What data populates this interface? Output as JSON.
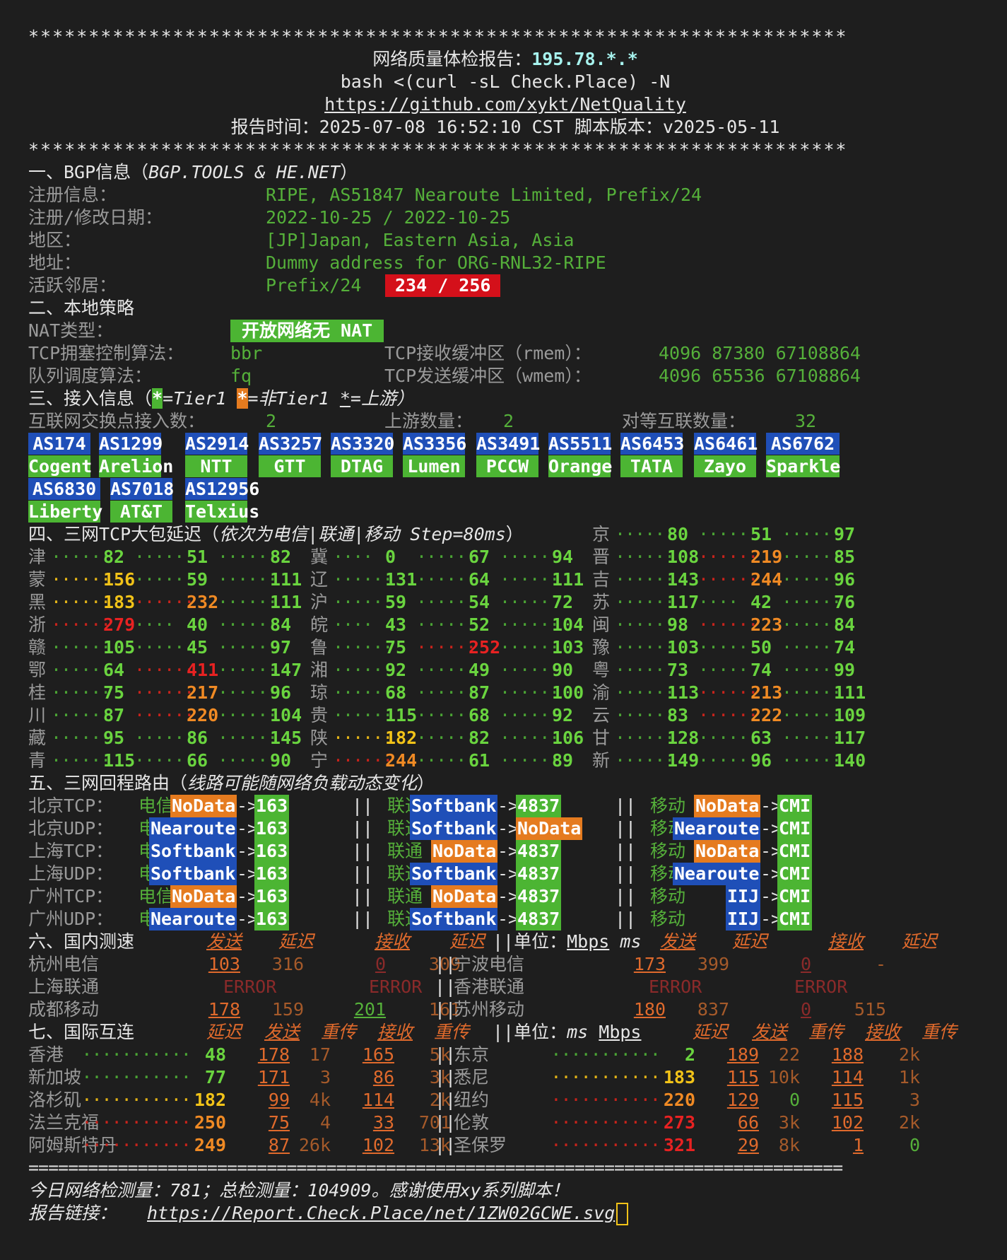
{
  "stars": "********************************************************************",
  "title_label": "网络质量体检报告：",
  "title_ip": "195.78.*.*",
  "cmd": "bash <(curl -sL Check.Place) -N",
  "repo": "https://github.com/xykt/NetQuality",
  "report_time": "报告时间：2025-07-08 16:52:10 CST  脚本版本：v2025-05-11",
  "sec1": {
    "title": "一、BGP信息（",
    "title_src": "BGP.TOOLS & HE.NET",
    "title_end": "）",
    "rows": [
      {
        "k": "注册信息：",
        "v": "RIPE, AS51847 Nearoute Limited, Prefix/24"
      },
      {
        "k": "注册/修改日期：",
        "v": "2022-10-25 / 2022-10-25"
      },
      {
        "k": "地区：",
        "v": "[JP]Japan, Eastern Asia, Asia"
      },
      {
        "k": "地址：",
        "v": "Dummy address for ORG-RNL32-RIPE"
      }
    ],
    "neighbor_k": "活跃邻居：",
    "neighbor_v": "Prefix/24",
    "neighbor_badge": "234 / 256"
  },
  "sec2": {
    "title": "二、本地策略",
    "nat_k": "NAT类型：",
    "nat_v": "开放网络无 NAT",
    "tcp_k": "TCP拥塞控制算法：",
    "tcp_v": "bbr",
    "rmem_k": "TCP接收缓冲区（rmem）：",
    "rmem_v": "4096 87380 67108864",
    "q_k": "队列调度算法：",
    "q_v": "fq",
    "wmem_k": "TCP发送缓冲区（wmem）：",
    "wmem_v": "4096 65536 67108864"
  },
  "sec3": {
    "title": "三、接入信息（",
    "t1": "*",
    "t1_txt": "=Tier1 ",
    "t2": "*",
    "t2_txt": "=非Tier1 ",
    "t3": "*",
    "t3_txt": "=上游）",
    "ix_k": "互联网交换点接入数：",
    "ix_v": "2",
    "up_k": "上游数量：",
    "up_v": "2",
    "peer_k": "对等互联数量：",
    "peer_v": "32",
    "asns": [
      {
        "as": "AS174",
        "name": "Cogent"
      },
      {
        "as": "AS1299",
        "name": "Arelion"
      },
      {
        "as": "AS2914",
        "name": "NTT"
      },
      {
        "as": "AS3257",
        "name": "GTT"
      },
      {
        "as": "AS3320",
        "name": "DTAG"
      },
      {
        "as": "AS3356",
        "name": "Lumen"
      },
      {
        "as": "AS3491",
        "name": "PCCW"
      },
      {
        "as": "AS5511",
        "name": "Orange"
      },
      {
        "as": "AS6453",
        "name": "TATA"
      },
      {
        "as": "AS6461",
        "name": "Zayo"
      },
      {
        "as": "AS6762",
        "name": "Sparkle"
      },
      {
        "as": "AS6830",
        "name": "Liberty"
      },
      {
        "as": "AS7018",
        "name": "AT&T"
      },
      {
        "as": "AS12956",
        "name": "Telxius"
      }
    ]
  },
  "sec4": {
    "title": "四、三网TCP大包延迟（",
    "title_it": "依次为电信|联通|移动 Step=80ms",
    "title_end": "）",
    "rows": [
      [
        {
          "p": "津",
          "v": [
            82,
            51,
            82
          ]
        },
        {
          "p": "冀",
          "v": [
            0,
            67,
            94
          ]
        },
        {
          "p": "晋",
          "v": [
            108,
            219,
            85
          ]
        }
      ],
      [
        {
          "p": "蒙",
          "v": [
            156,
            59,
            111
          ]
        },
        {
          "p": "辽",
          "v": [
            131,
            64,
            111
          ]
        },
        {
          "p": "吉",
          "v": [
            143,
            244,
            96
          ]
        }
      ],
      [
        {
          "p": "黑",
          "v": [
            183,
            232,
            111
          ]
        },
        {
          "p": "沪",
          "v": [
            59,
            54,
            72
          ]
        },
        {
          "p": "苏",
          "v": [
            117,
            42,
            76
          ]
        }
      ],
      [
        {
          "p": "浙",
          "v": [
            279,
            40,
            84
          ]
        },
        {
          "p": "皖",
          "v": [
            43,
            52,
            104
          ]
        },
        {
          "p": "闽",
          "v": [
            98,
            223,
            84
          ]
        }
      ],
      [
        {
          "p": "赣",
          "v": [
            105,
            45,
            97
          ]
        },
        {
          "p": "鲁",
          "v": [
            75,
            252,
            103
          ]
        },
        {
          "p": "豫",
          "v": [
            103,
            50,
            74
          ]
        }
      ],
      [
        {
          "p": "鄂",
          "v": [
            64,
            411,
            147
          ]
        },
        {
          "p": "湘",
          "v": [
            92,
            49,
            90
          ]
        },
        {
          "p": "粤",
          "v": [
            73,
            74,
            99
          ]
        }
      ],
      [
        {
          "p": "桂",
          "v": [
            75,
            217,
            96
          ]
        },
        {
          "p": "琼",
          "v": [
            68,
            87,
            100
          ]
        },
        {
          "p": "渝",
          "v": [
            113,
            213,
            111
          ]
        }
      ],
      [
        {
          "p": "川",
          "v": [
            87,
            220,
            104
          ]
        },
        {
          "p": "贵",
          "v": [
            115,
            68,
            92
          ]
        },
        {
          "p": "云",
          "v": [
            83,
            222,
            109
          ]
        }
      ],
      [
        {
          "p": "藏",
          "v": [
            95,
            86,
            145
          ]
        },
        {
          "p": "陕",
          "v": [
            182,
            82,
            106
          ]
        },
        {
          "p": "甘",
          "v": [
            128,
            63,
            117
          ]
        }
      ],
      [
        {
          "p": "青",
          "v": [
            115,
            66,
            90
          ]
        },
        {
          "p": "宁",
          "v": [
            244,
            61,
            89
          ]
        },
        {
          "p": "新",
          "v": [
            149,
            96,
            140
          ]
        }
      ]
    ],
    "jing": {
      "p": "京",
      "v": [
        80,
        51,
        97
      ]
    }
  },
  "sec5": {
    "title": "五、三网回程路由（",
    "title_it": "线路可能随网络负载动态变化",
    "title_end": "）",
    "ct": "电信",
    "cu": "联通",
    "cm": "移动",
    "rows": [
      {
        "loc": "北京TCP：",
        "ct": "NoData",
        "ct_t": "163",
        "cu": "Softbank",
        "cu_t": "4837",
        "cm": "NoData",
        "cm_t": "CMI"
      },
      {
        "loc": "北京UDP：",
        "ct": "Nearoute",
        "ct_t": "163",
        "cu": "Softbank",
        "cu_t": "NoData",
        "cm": "Nearoute",
        "cm_t": "CMI"
      },
      {
        "loc": "上海TCP：",
        "ct": "Softbank",
        "ct_t": "163",
        "cu": "NoData",
        "cu_t": "4837",
        "cm": "NoData",
        "cm_t": "CMI"
      },
      {
        "loc": "上海UDP：",
        "ct": "Softbank",
        "ct_t": "163",
        "cu": "Softbank",
        "cu_t": "4837",
        "cm": "Nearoute",
        "cm_t": "CMI"
      },
      {
        "loc": "广州TCP：",
        "ct": "NoData",
        "ct_t": "163",
        "cu": "NoData",
        "cu_t": "4837",
        "cm": "IIJ",
        "cm_t": "CMI"
      },
      {
        "loc": "广州UDP：",
        "ct": "Nearoute",
        "ct_t": "163",
        "cu": "Softbank",
        "cu_t": "4837",
        "cm": "IIJ",
        "cm_t": "CMI"
      }
    ]
  },
  "sec6": {
    "title": "六、国内测速",
    "h_send": "发送",
    "h_lat": "延迟",
    "h_recv": "接收",
    "h_lat2": "延迟",
    "unit": "||单位：",
    "unit_mbps": "Mbps",
    "unit_ms": "ms",
    "left": [
      {
        "n": "杭州电信",
        "send": "103",
        "lat": "316",
        "recv": "0",
        "lat2": "309"
      },
      {
        "n": "上海联通",
        "error": "ERROR",
        "error2": "ERROR"
      },
      {
        "n": "成都移动",
        "send": "178",
        "lat": "159",
        "recv": "201",
        "lat2": "161"
      }
    ],
    "right": [
      {
        "n": "宁波电信",
        "send": "173",
        "lat": "399",
        "recv": "0",
        "lat2": "-"
      },
      {
        "n": "香港联通",
        "error": "ERROR",
        "error2": "ERROR"
      },
      {
        "n": "苏州移动",
        "send": "180",
        "lat": "837",
        "recv": "0",
        "lat2": "515"
      }
    ]
  },
  "sec7": {
    "title": "七、国际互连",
    "h_lat": "延迟",
    "h_send": "发送",
    "h_ret": "重传",
    "h_recv": "接收",
    "h_ret2": "重传",
    "unit": "||单位：",
    "unit_ms": "ms",
    "unit_mbps": "Mbps",
    "left": [
      {
        "n": "香港",
        "lat": "48",
        "send": "178",
        "r1": "17",
        "recv": "165",
        "r2": "5k"
      },
      {
        "n": "新加坡",
        "lat": "77",
        "send": "171",
        "r1": "3",
        "recv": "86",
        "r2": "3k"
      },
      {
        "n": "洛杉矶",
        "lat": "182",
        "send": "99",
        "r1": "4k",
        "recv": "114",
        "r2": "2k"
      },
      {
        "n": "法兰克福",
        "lat": "250",
        "send": "75",
        "r1": "4",
        "recv": "33",
        "r2": "701"
      },
      {
        "n": "阿姆斯特丹",
        "lat": "249",
        "send": "87",
        "r1": "26k",
        "recv": "102",
        "r2": "13k"
      }
    ],
    "right": [
      {
        "n": "东京",
        "lat": "2",
        "send": "189",
        "r1": "22",
        "recv": "188",
        "r2": "2k"
      },
      {
        "n": "悉尼",
        "lat": "183",
        "send": "115",
        "r1": "10k",
        "recv": "114",
        "r2": "1k"
      },
      {
        "n": "纽约",
        "lat": "220",
        "send": "129",
        "r1": "0",
        "recv": "115",
        "r2": "3"
      },
      {
        "n": "伦敦",
        "lat": "273",
        "send": "66",
        "r1": "3k",
        "recv": "102",
        "r2": "2k"
      },
      {
        "n": "圣保罗",
        "lat": "321",
        "send": "29",
        "r1": "8k",
        "recv": "1",
        "r2": "0"
      }
    ]
  },
  "equals": "==================================================================================",
  "footer": {
    "count": "今日网络检测量：781；总检测量：104909。感谢使用xy系列脚本！",
    "link_k": "报告链接：",
    "link_v": "https://Report.Check.Place/net/1ZW02GCWE.svg"
  },
  "colors": {
    "green": "#6ad43f",
    "yellow": "#f2c318",
    "orange": "#f08a24",
    "red": "#e82222",
    "blue_box": "#1f4fb8",
    "green_box": "#4cb533"
  }
}
